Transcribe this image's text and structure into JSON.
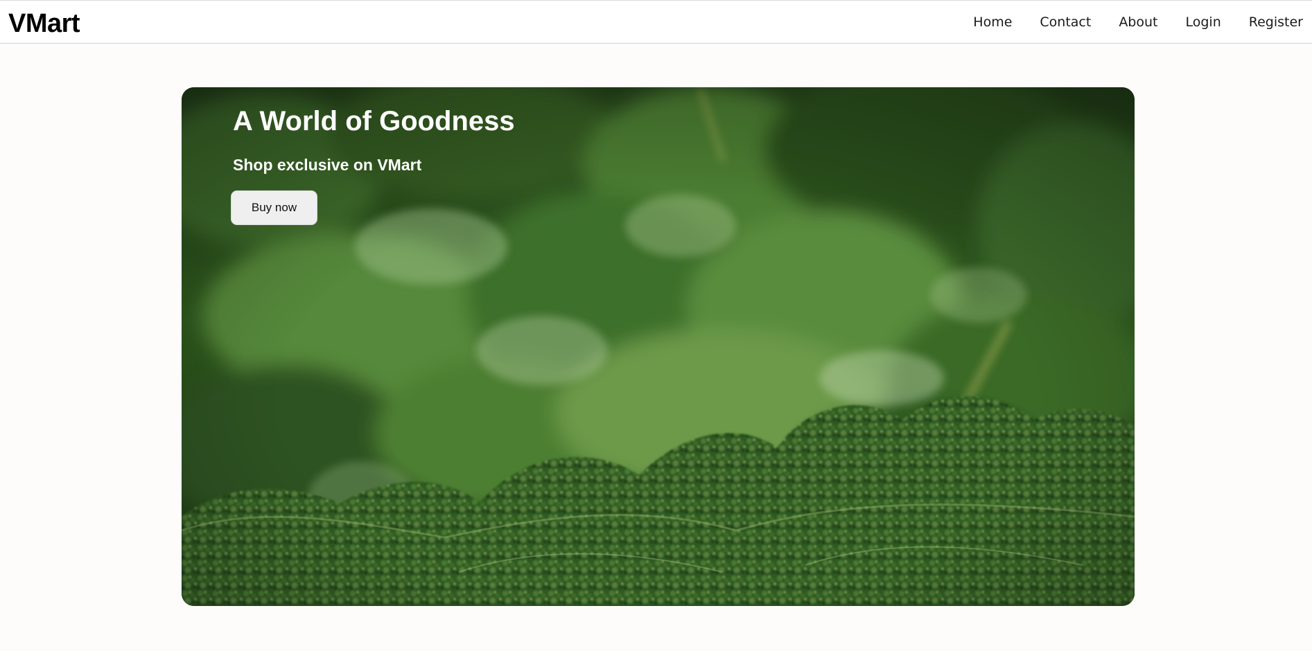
{
  "brand": "VMart",
  "nav": {
    "home": "Home",
    "contact": "Contact",
    "about": "About",
    "login": "Login",
    "register": "Register"
  },
  "hero": {
    "title": "A World of Goodness",
    "subtitle": "Shop exclusive on VMart",
    "button_label": "Buy now",
    "image": "kale-leafy-greens-photo"
  },
  "colors": {
    "page_background": "#fdfcfa",
    "navbar_background": "#ffffff",
    "hero_text": "#ffffff",
    "button_background": "#efefef"
  }
}
